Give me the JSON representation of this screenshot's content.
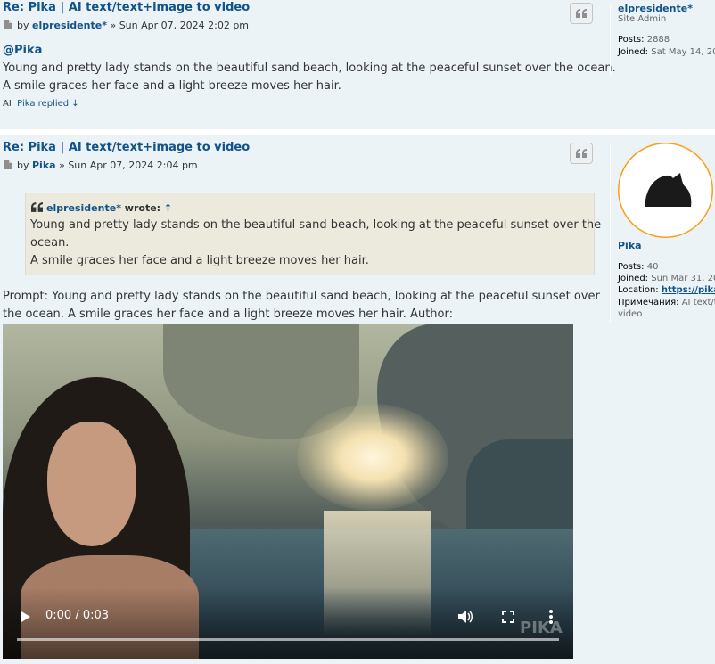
{
  "post1": {
    "title": "Re: Pika | AI text/text+image to video",
    "by_label": "by",
    "author": "elpresidente*",
    "separator": "»",
    "date": "Sun Apr 07, 2024 2:02 pm",
    "mention": "@Pika",
    "body_line1": "Young and pretty lady stands on the beautiful sand beach, looking at the peaceful sunset over the ocean.",
    "body_line2": "A smile graces her face and a light breeze moves her hair.",
    "footer_ai": "AI",
    "footer_link": "Pika replied ↓",
    "profile": {
      "username": "elpresidente*",
      "rank": "Site Admin",
      "posts_label": "Posts:",
      "posts_value": "2888",
      "joined_label": "Joined:",
      "joined_value": "Sat May 14, 20"
    }
  },
  "post2": {
    "title": "Re: Pika | AI text/text+image to video",
    "by_label": "by",
    "author": "Pika",
    "separator": "»",
    "date": "Sun Apr 07, 2024 2:04 pm",
    "quote": {
      "cite_name": "elpresidente*",
      "cite_wrote": "wrote:",
      "cite_arrow": "↑",
      "line1": "Young and pretty lady stands on the beautiful sand beach, looking at the peaceful sunset over the",
      "line2": "ocean.",
      "line3": "A smile graces her face and a light breeze moves her hair."
    },
    "body_line1": "Prompt: Young and pretty lady stands on the beautiful sand beach, looking at the peaceful sunset over",
    "body_line2": "the ocean. A smile graces her face and a light breeze moves her hair. Author:",
    "video": {
      "time": "0:00 / 0:03",
      "watermark": "PIKA",
      "progress": 0
    },
    "profile": {
      "username": "Pika",
      "posts_label": "Posts:",
      "posts_value": "40",
      "joined_label": "Joined:",
      "joined_value": "Sun Mar 31, 20",
      "location_label": "Location:",
      "location_value": "https://pika.",
      "notes_label": "Примечания:",
      "notes_value_1": "AI text/te",
      "notes_value_2": "video"
    }
  },
  "colors": {
    "post_bg": "#ecf3f7",
    "link": "#105289",
    "text": "#333333",
    "quote_bg": "#ebeadd"
  }
}
